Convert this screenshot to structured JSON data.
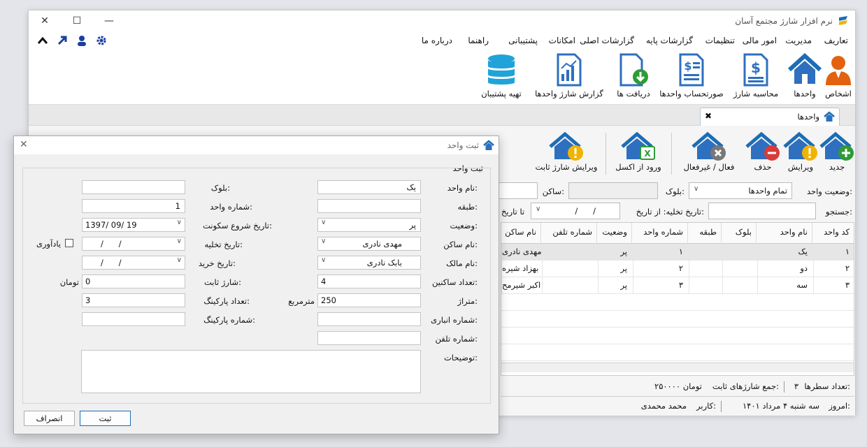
{
  "app": {
    "title": "نرم افزار شارژ مجتمع آسان",
    "window_buttons": {
      "close": "✕",
      "maximize": "☐",
      "minimize": "—"
    }
  },
  "menu": [
    "تعاریف",
    "مدیریت",
    "امور مالی",
    "تنظیمات",
    "گزارشات پایه",
    "گزارشات اصلی",
    "امکانات",
    "پشتیبانی",
    "راهنما",
    "درباره ما"
  ],
  "ribbon": {
    "buttons": [
      {
        "label": "اشخاص",
        "icon": "person-icon"
      },
      {
        "label": "واحدها",
        "icon": "home-icon"
      },
      {
        "label": "محاسبه شارژ",
        "icon": "invoice-dollar-icon"
      },
      {
        "label": "صورتحساب واحدها",
        "icon": "statement-dollar-icon"
      },
      {
        "label": "دریافت ها",
        "icon": "receipt-download-icon"
      },
      {
        "label": "گزارش شارژ واحدها",
        "icon": "report-chart-icon"
      },
      {
        "label": "تهیه پشتیبان",
        "icon": "database-icon"
      }
    ]
  },
  "tab": {
    "label": "واحدها",
    "close": "✖"
  },
  "units_toolbar": [
    {
      "label": "جدید",
      "icon": "home-add-icon"
    },
    {
      "label": "ویرایش",
      "icon": "home-warning-icon"
    },
    {
      "label": "حذف",
      "icon": "home-remove-icon"
    },
    {
      "label": "فعال / غیرفعال",
      "icon": "home-disable-icon"
    },
    {
      "label": "ورود از اکسل",
      "icon": "home-excel-icon"
    },
    {
      "label": "ویرایش شارژ ثابت",
      "icon": "home-warning-icon"
    }
  ],
  "filters": {
    "status_label": "وضعیت واحد:",
    "status_value": "تمام واحدها",
    "block_label": "بلوک:",
    "resident_label": "ساکن:",
    "search_label": "جستجو:",
    "evac_label": "تاریخ تخلیه: از تاریخ:",
    "date_placeholder": "/      /",
    "to_date_label": "تا تاریخ"
  },
  "grid": {
    "columns": [
      "کد واحد",
      "نام واحد",
      "بلوک",
      "طبقه",
      "شماره واحد",
      "وضعیت",
      "شماره تلفن",
      "نام ساکن"
    ],
    "rows": [
      {
        "code": "۱",
        "name": "یک",
        "block": "",
        "floor": "",
        "number": "۱",
        "status": "پر",
        "phone": "",
        "resident": "مهدی نادری"
      },
      {
        "code": "۲",
        "name": "دو",
        "block": "",
        "floor": "",
        "number": "۲",
        "status": "پر",
        "phone": "",
        "resident": "بهزاد شیره"
      },
      {
        "code": "۳",
        "name": "سه",
        "block": "",
        "floor": "",
        "number": "۳",
        "status": "پر",
        "phone": "",
        "resident": "اکبر شیرمح"
      }
    ]
  },
  "status": {
    "row_count_label": "تعداد سطرها:",
    "row_count": "۳",
    "total_label": "جمع شارژهای ثابت:",
    "total_value": "۲۵۰۰۰۰ تومان",
    "today_label": "امروز:",
    "today_value": "سه شنبه ۴ مرداد ۱۴۰۱",
    "user_label": "کاربر:",
    "user_value": "محمد محمدی"
  },
  "dialog": {
    "title": "ثبت واحد",
    "group_title": "ثبت واحد",
    "close": "✕",
    "right_fields": [
      {
        "label": "نام واحد:",
        "value": "یک",
        "type": "text"
      },
      {
        "label": "طبقه:",
        "value": "",
        "type": "text"
      },
      {
        "label": "وضعیت:",
        "value": "پر",
        "type": "select"
      },
      {
        "label": "نام ساکن:",
        "value": "مهدی نادری",
        "type": "select"
      },
      {
        "label": "نام مالک:",
        "value": "بابک نادری",
        "type": "select"
      },
      {
        "label": "تعداد ساکنین:",
        "value": "4",
        "type": "text"
      },
      {
        "label": "متراژ:",
        "value": "250",
        "type": "text",
        "unit": "مترمربع"
      },
      {
        "label": "شماره انباری:",
        "value": "",
        "type": "text"
      },
      {
        "label": "شماره تلفن:",
        "value": "",
        "type": "text"
      }
    ],
    "left_fields": [
      {
        "label": "بلوک:",
        "value": "",
        "type": "text"
      },
      {
        "label": "شماره واحد:",
        "value": "1",
        "type": "text"
      },
      {
        "label": "تاریخ شروع سکونت:",
        "value": "1397/ 09/ 19",
        "type": "date"
      },
      {
        "label": "تاریخ تخلیه:",
        "value": "/      /",
        "type": "date"
      },
      {
        "label": "تاریخ خرید:",
        "value": "/      /",
        "type": "date"
      },
      {
        "label": "شارژ ثابت:",
        "value": "0",
        "type": "text",
        "unit": "تومان"
      },
      {
        "label": "تعداد پارکینگ:",
        "value": "3",
        "type": "text"
      },
      {
        "label": "شماره پارکینگ:",
        "value": "",
        "type": "text"
      }
    ],
    "reminder_label": "یادآوری",
    "notes_label": "توضیحات:",
    "submit": "ثبت",
    "cancel": "انصراف"
  },
  "colors": {
    "accent": "#1b6db7",
    "icon_blue": "#2e6fbf",
    "icon_orange": "#e2620f",
    "icon_green": "#2e9b35",
    "icon_red": "#d93b3b",
    "icon_yellow": "#f0b400"
  }
}
